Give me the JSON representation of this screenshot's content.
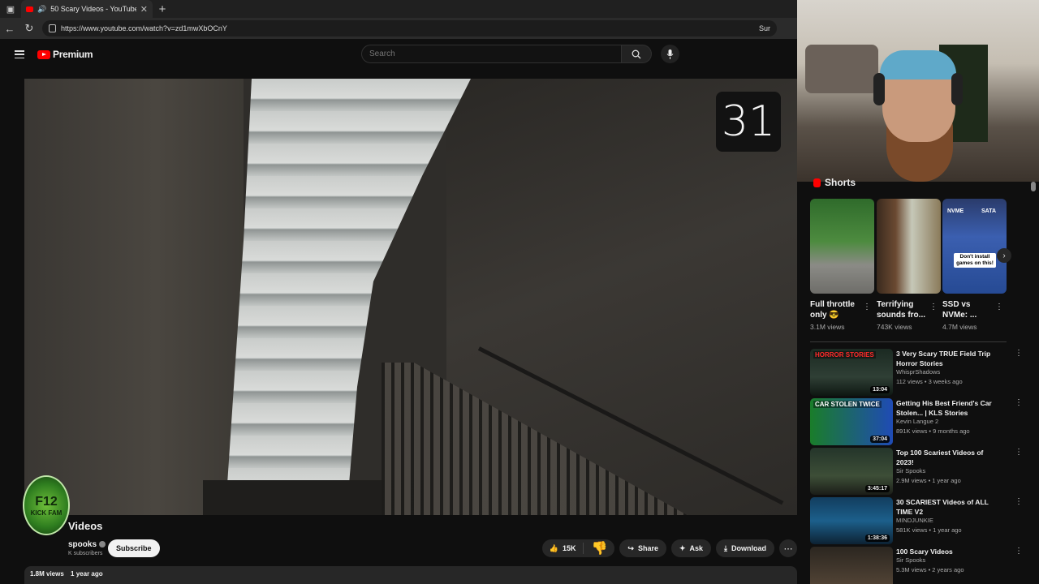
{
  "browser": {
    "tab_title": "50 Scary Videos - YouTube",
    "url": "https://www.youtube.com/watch?v=zd1mwXbOCnY",
    "right_text": "Sur"
  },
  "header": {
    "logo_text": "Premium",
    "search_placeholder": "Search"
  },
  "player": {
    "counter": "31"
  },
  "video": {
    "title": "Videos",
    "channel": "spooks",
    "subscribers": "K subscribers",
    "subscribe_label": "Subscribe",
    "likes": "15K",
    "share_label": "Share",
    "ask_label": "Ask",
    "download_label": "Download",
    "views": "1.8M views",
    "age": "1 year ago"
  },
  "overlay_logo": {
    "line1": "F12",
    "line2": "KICK FAM"
  },
  "shorts": {
    "title": "Shorts",
    "items": [
      {
        "title": "Full throttle only 😎",
        "views": "3.1M views"
      },
      {
        "title": "Terrifying sounds fro...",
        "views": "743K views"
      },
      {
        "title": "SSD vs NVMe: ...",
        "views": "4.7M views"
      }
    ],
    "nvme_labels": [
      "NVME",
      "SATA"
    ],
    "nvme_badge": "Don't install games on this!"
  },
  "recommendations": [
    {
      "title": "3 Very Scary TRUE Field Trip Horror Stories",
      "channel": "WhisprShadows",
      "meta": "112 views • 3 weeks ago",
      "duration": "13:04",
      "tag": "HORROR STORIES"
    },
    {
      "title": "Getting His Best Friend's Car Stolen... | KLS Stories",
      "channel": "Kevin Langue 2",
      "meta": "891K views • 9 months ago",
      "duration": "37:04",
      "tag": "CAR STOLEN TWICE"
    },
    {
      "title": "Top 100 Scariest Videos of 2023!",
      "channel": "Sir Spooks",
      "meta": "2.9M views • 1 year ago",
      "duration": "3:45:17",
      "tag": ""
    },
    {
      "title": "30 SCARIEST Videos of ALL TIME V2",
      "channel": "MINDJUNKIE",
      "meta": "581K views • 1 year ago",
      "duration": "1:38:36",
      "tag": ""
    },
    {
      "title": "100 Scary Videos",
      "channel": "Sir Spooks",
      "meta": "5.3M views • 2 years ago",
      "duration": "",
      "tag": ""
    }
  ]
}
